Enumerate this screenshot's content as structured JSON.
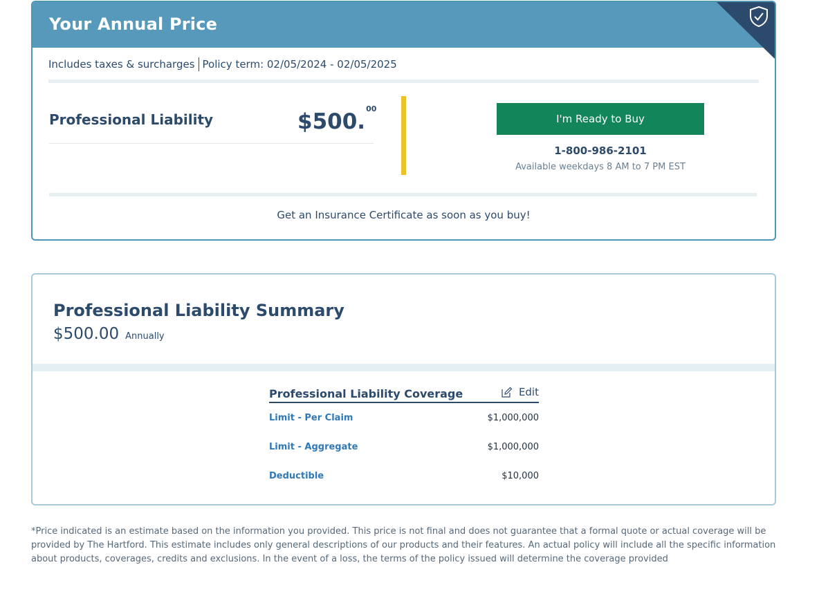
{
  "price_card": {
    "title": "Your Annual Price",
    "taxes_note": "Includes taxes & surcharges",
    "policy_term": "Policy term: 02/05/2024 - 02/05/2025",
    "product_name": "Professional Liability",
    "price_main": "$500.",
    "price_cents": "00",
    "buy_label": "I'm Ready to Buy",
    "phone": "1-800-986-2101",
    "hours": "Available weekdays 8 AM to 7 PM EST",
    "certificate_note": "Get an Insurance Certificate as soon as you buy!",
    "icon": "shield-check-icon"
  },
  "summary": {
    "title": "Professional Liability Summary",
    "price": "$500.00",
    "frequency": "Annually",
    "coverage": {
      "title": "Professional Liability Coverage",
      "edit_label": "Edit",
      "rows": [
        {
          "label": "Limit - Per Claim",
          "value": "$1,000,000"
        },
        {
          "label": "Limit - Aggregate",
          "value": "$1,000,000"
        },
        {
          "label": "Deductible",
          "value": "$10,000"
        }
      ]
    }
  },
  "disclaimer": "*Price indicated is an estimate based on the information you provided. This price is not final and does not guarantee that a formal quote or actual coverage will be provided by The Hartford. This estimate includes only general descriptions of our products and their features. An actual policy will include all the specific information about products, coverages, credits and exclusions. In the event of a loss, the terms of the policy issued will determine the coverage provided",
  "colors": {
    "header_blue": "#5799bb",
    "ribbon_navy": "#2c4a6b",
    "buy_green": "#13855a",
    "accent_yellow": "#e8c32a",
    "link_blue": "#3078b6"
  }
}
